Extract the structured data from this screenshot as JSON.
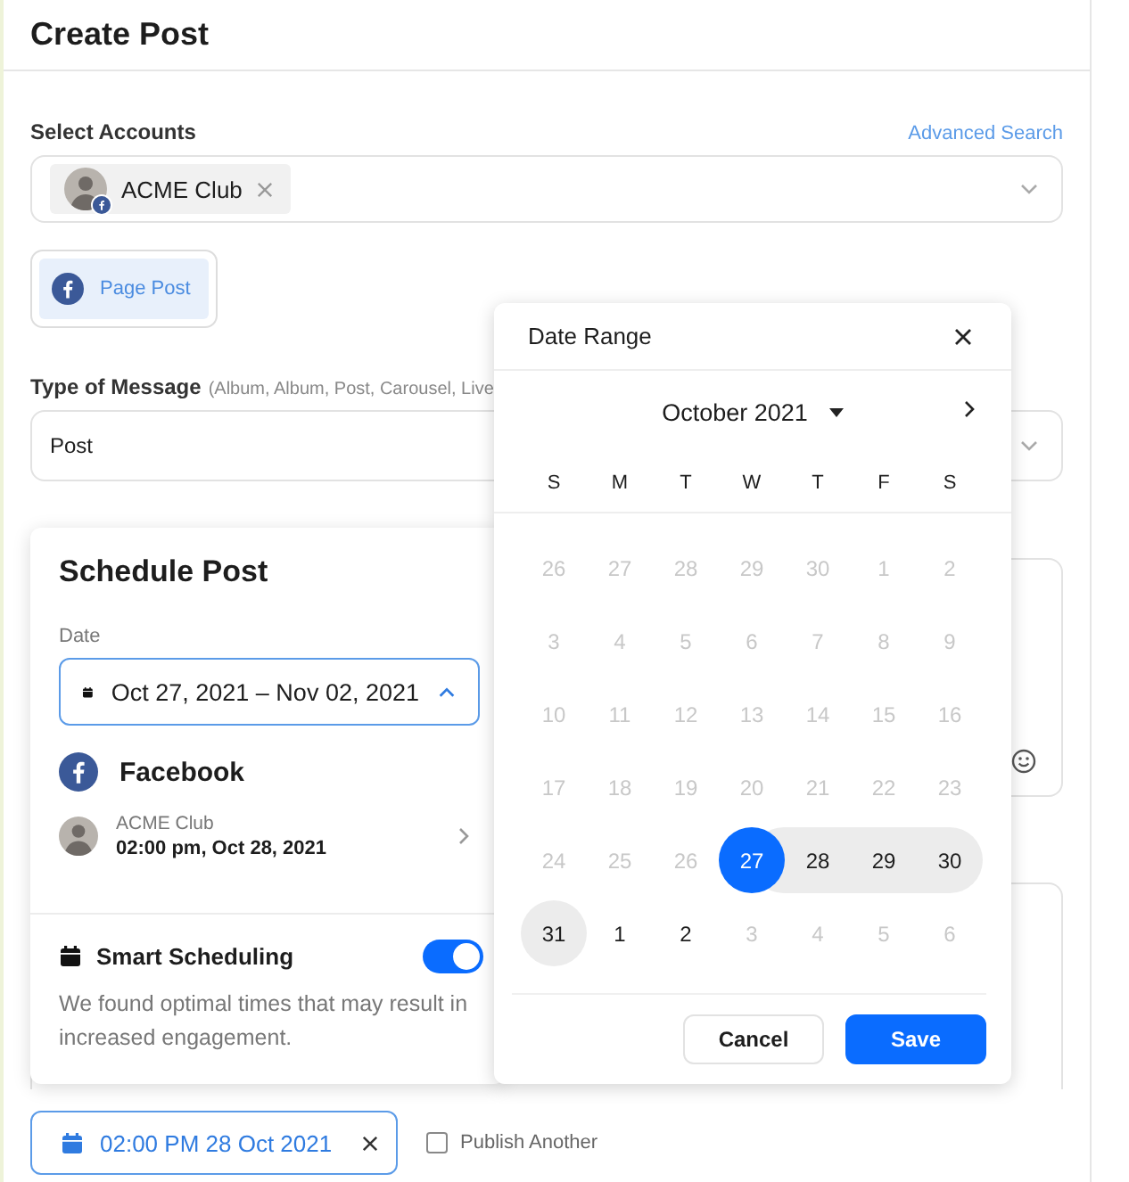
{
  "page": {
    "title": "Create Post"
  },
  "accounts": {
    "label": "Select Accounts",
    "link": "Advanced Search",
    "chips": [
      {
        "name": "ACME Club"
      }
    ]
  },
  "post_types": [
    {
      "label": "Page Post",
      "selected": true
    }
  ],
  "message_type": {
    "label": "Type of Message",
    "hint": "(Album, Album, Post, Carousel, Live",
    "value": "Post"
  },
  "schedule_post": {
    "title": "Schedule Post",
    "date_label": "Date",
    "date_value": "Oct 27, 2021 – Nov 02, 2021",
    "network": "Facebook",
    "account": {
      "name": "ACME Club",
      "time": "02:00 pm, Oct 28, 2021"
    },
    "smart_scheduling": {
      "title": "Smart Scheduling",
      "on": true,
      "description": "We found optimal times that may result in increased engagement."
    }
  },
  "date_range": {
    "title": "Date Range",
    "month": "October 2021",
    "weekdays": [
      "S",
      "M",
      "T",
      "W",
      "T",
      "F",
      "S"
    ],
    "days": [
      {
        "day": "26",
        "disabled": true,
        "selected": false,
        "in_range": false
      },
      {
        "day": "27",
        "disabled": true,
        "selected": false,
        "in_range": false
      },
      {
        "day": "28",
        "disabled": true,
        "selected": false,
        "in_range": false
      },
      {
        "day": "29",
        "disabled": true,
        "selected": false,
        "in_range": false
      },
      {
        "day": "30",
        "disabled": true,
        "selected": false,
        "in_range": false
      },
      {
        "day": "1",
        "disabled": true,
        "selected": false,
        "in_range": false
      },
      {
        "day": "2",
        "disabled": true,
        "selected": false,
        "in_range": false
      },
      {
        "day": "3",
        "disabled": true,
        "selected": false,
        "in_range": false
      },
      {
        "day": "4",
        "disabled": true,
        "selected": false,
        "in_range": false
      },
      {
        "day": "5",
        "disabled": true,
        "selected": false,
        "in_range": false
      },
      {
        "day": "6",
        "disabled": true,
        "selected": false,
        "in_range": false
      },
      {
        "day": "7",
        "disabled": true,
        "selected": false,
        "in_range": false
      },
      {
        "day": "8",
        "disabled": true,
        "selected": false,
        "in_range": false
      },
      {
        "day": "9",
        "disabled": true,
        "selected": false,
        "in_range": false
      },
      {
        "day": "10",
        "disabled": true,
        "selected": false,
        "in_range": false
      },
      {
        "day": "11",
        "disabled": true,
        "selected": false,
        "in_range": false
      },
      {
        "day": "12",
        "disabled": true,
        "selected": false,
        "in_range": false
      },
      {
        "day": "13",
        "disabled": true,
        "selected": false,
        "in_range": false
      },
      {
        "day": "14",
        "disabled": true,
        "selected": false,
        "in_range": false
      },
      {
        "day": "15",
        "disabled": true,
        "selected": false,
        "in_range": false
      },
      {
        "day": "16",
        "disabled": true,
        "selected": false,
        "in_range": false
      },
      {
        "day": "17",
        "disabled": true,
        "selected": false,
        "in_range": false
      },
      {
        "day": "18",
        "disabled": true,
        "selected": false,
        "in_range": false
      },
      {
        "day": "19",
        "disabled": true,
        "selected": false,
        "in_range": false
      },
      {
        "day": "20",
        "disabled": true,
        "selected": false,
        "in_range": false
      },
      {
        "day": "21",
        "disabled": true,
        "selected": false,
        "in_range": false
      },
      {
        "day": "22",
        "disabled": true,
        "selected": false,
        "in_range": false
      },
      {
        "day": "23",
        "disabled": true,
        "selected": false,
        "in_range": false
      },
      {
        "day": "24",
        "disabled": true,
        "selected": false,
        "in_range": false
      },
      {
        "day": "25",
        "disabled": true,
        "selected": false,
        "in_range": false
      },
      {
        "day": "26",
        "disabled": true,
        "selected": false,
        "in_range": false
      },
      {
        "day": "27",
        "disabled": false,
        "selected": true,
        "in_range": false
      },
      {
        "day": "28",
        "disabled": false,
        "selected": false,
        "in_range": true
      },
      {
        "day": "29",
        "disabled": false,
        "selected": false,
        "in_range": true
      },
      {
        "day": "30",
        "disabled": false,
        "selected": false,
        "in_range": true
      },
      {
        "day": "31",
        "disabled": false,
        "selected": false,
        "in_range": true
      },
      {
        "day": "1",
        "disabled": false,
        "selected": false,
        "in_range": false
      },
      {
        "day": "2",
        "disabled": false,
        "selected": false,
        "in_range": false
      },
      {
        "day": "3",
        "disabled": true,
        "selected": false,
        "in_range": false
      },
      {
        "day": "4",
        "disabled": true,
        "selected": false,
        "in_range": false
      },
      {
        "day": "5",
        "disabled": true,
        "selected": false,
        "in_range": false
      },
      {
        "day": "6",
        "disabled": true,
        "selected": false,
        "in_range": false
      }
    ],
    "buttons": [
      {
        "label": "Cancel",
        "kind": "secondary"
      },
      {
        "label": "Save",
        "kind": "primary"
      }
    ]
  },
  "footer": {
    "date_chip": "02:00 PM 28 Oct 2021",
    "publish_another": {
      "label": "Publish Another",
      "checked": false
    }
  }
}
